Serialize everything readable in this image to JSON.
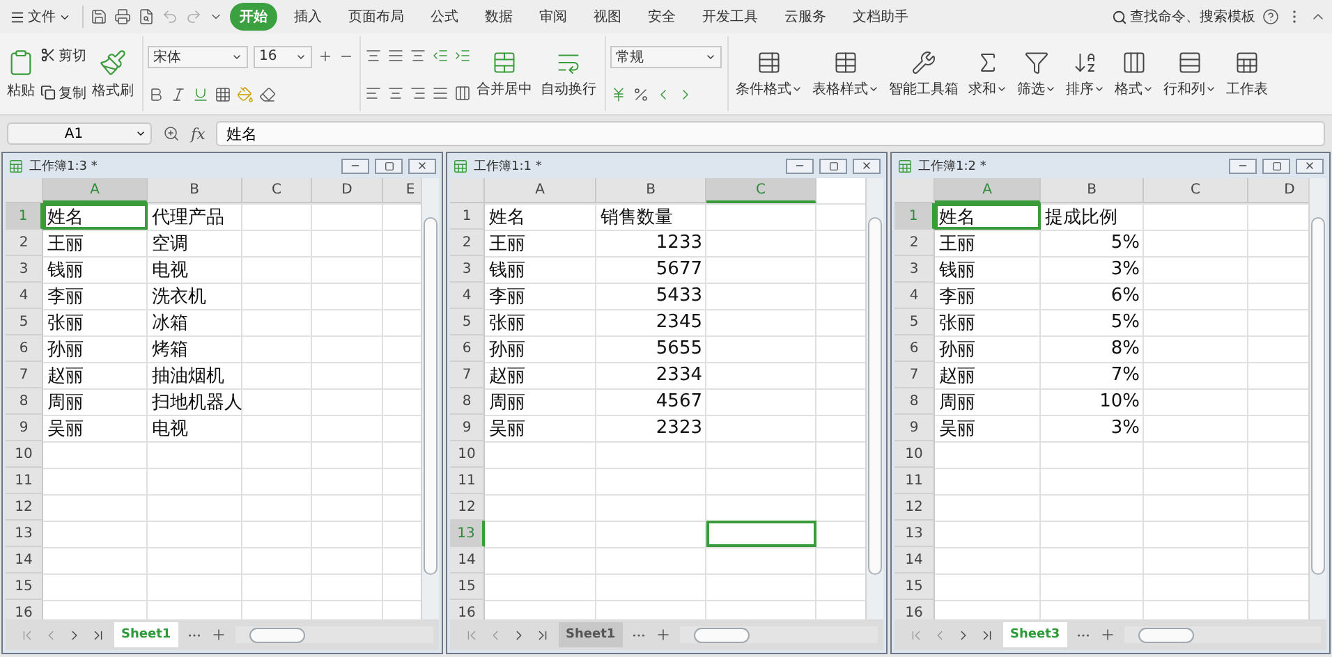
{
  "menu_bar": {
    "file": "文件",
    "tabs": [
      {
        "label": "开始",
        "selected": true
      },
      {
        "label": "插入",
        "selected": false
      },
      {
        "label": "页面布局",
        "selected": false
      },
      {
        "label": "公式",
        "selected": false
      },
      {
        "label": "数据",
        "selected": false
      },
      {
        "label": "审阅",
        "selected": false
      },
      {
        "label": "视图",
        "selected": false
      },
      {
        "label": "安全",
        "selected": false
      },
      {
        "label": "开发工具",
        "selected": false
      },
      {
        "label": "云服务",
        "selected": false
      },
      {
        "label": "文档助手",
        "selected": false
      }
    ],
    "search": "查找命令、搜索模板"
  },
  "ribbon": {
    "paste": "粘贴",
    "cut": "剪切",
    "copy": "复制",
    "format_painter": "格式刷",
    "font_name": "宋体",
    "font_size": "16",
    "merge": "合并居中",
    "wrap": "自动换行",
    "number_format": "常规",
    "tools": [
      {
        "label": "条件格式",
        "dropdown": true
      },
      {
        "label": "表格样式",
        "dropdown": true
      },
      {
        "label": "智能工具箱",
        "dropdown": false
      },
      {
        "label": "求和",
        "dropdown": true
      },
      {
        "label": "筛选",
        "dropdown": true
      },
      {
        "label": "排序",
        "dropdown": true
      },
      {
        "label": "格式",
        "dropdown": true
      },
      {
        "label": "行和列",
        "dropdown": true
      },
      {
        "label": "工作表",
        "dropdown": false
      }
    ]
  },
  "formula_bar": {
    "name_box": "A1",
    "function_label": "fx",
    "formula": "姓名"
  },
  "windows": [
    {
      "title": "工作簿1:3 *",
      "columns": [
        {
          "label": "A",
          "selected": true
        },
        {
          "label": "B",
          "selected": false
        },
        {
          "label": "C",
          "selected": false
        },
        {
          "label": "D",
          "selected": false
        },
        {
          "label": "E",
          "selected": false
        }
      ],
      "rows": [
        {
          "label": "1",
          "selected": true,
          "cells": [
            {
              "text": "姓名",
              "kind": "text",
              "selected": true
            },
            {
              "text": "代理产品",
              "kind": "text",
              "selected": false
            }
          ]
        },
        {
          "label": "2",
          "selected": false,
          "cells": [
            {
              "text": "王丽",
              "kind": "text",
              "selected": false
            },
            {
              "text": "空调",
              "kind": "text",
              "selected": false
            }
          ]
        },
        {
          "label": "3",
          "selected": false,
          "cells": [
            {
              "text": "钱丽",
              "kind": "text",
              "selected": false
            },
            {
              "text": "电视",
              "kind": "text",
              "selected": false
            }
          ]
        },
        {
          "label": "4",
          "selected": false,
          "cells": [
            {
              "text": "李丽",
              "kind": "text",
              "selected": false
            },
            {
              "text": "洗衣机",
              "kind": "text",
              "selected": false
            }
          ]
        },
        {
          "label": "5",
          "selected": false,
          "cells": [
            {
              "text": "张丽",
              "kind": "text",
              "selected": false
            },
            {
              "text": "冰箱",
              "kind": "text",
              "selected": false
            }
          ]
        },
        {
          "label": "6",
          "selected": false,
          "cells": [
            {
              "text": "孙丽",
              "kind": "text",
              "selected": false
            },
            {
              "text": "烤箱",
              "kind": "text",
              "selected": false
            }
          ]
        },
        {
          "label": "7",
          "selected": false,
          "cells": [
            {
              "text": "赵丽",
              "kind": "text",
              "selected": false
            },
            {
              "text": "抽油烟机",
              "kind": "text",
              "selected": false
            }
          ]
        },
        {
          "label": "8",
          "selected": false,
          "cells": [
            {
              "text": "周丽",
              "kind": "text",
              "selected": false
            },
            {
              "text": "扫地机器人",
              "kind": "text",
              "selected": false
            }
          ]
        },
        {
          "label": "9",
          "selected": false,
          "cells": [
            {
              "text": "吴丽",
              "kind": "text",
              "selected": false
            },
            {
              "text": "电视",
              "kind": "text",
              "selected": false
            }
          ]
        },
        {
          "label": "10",
          "selected": false,
          "cells": []
        },
        {
          "label": "11",
          "selected": false,
          "cells": []
        },
        {
          "label": "12",
          "selected": false,
          "cells": []
        },
        {
          "label": "13",
          "selected": false,
          "cells": []
        },
        {
          "label": "14",
          "selected": false,
          "cells": []
        },
        {
          "label": "15",
          "selected": false,
          "cells": []
        },
        {
          "label": "16",
          "selected": false,
          "cells": []
        }
      ],
      "sheet_tab": {
        "label": "Sheet1",
        "selected": true
      }
    },
    {
      "title": "工作簿1:1 *",
      "columns": [
        {
          "label": "A",
          "selected": false
        },
        {
          "label": "B",
          "selected": false
        },
        {
          "label": "C",
          "selected": true
        }
      ],
      "rows": [
        {
          "label": "1",
          "selected": false,
          "cells": [
            {
              "text": "姓名",
              "kind": "text",
              "selected": false
            },
            {
              "text": "销售数量",
              "kind": "text",
              "selected": false
            }
          ]
        },
        {
          "label": "2",
          "selected": false,
          "cells": [
            {
              "text": "王丽",
              "kind": "text",
              "selected": false
            },
            {
              "text": "1233",
              "kind": "number",
              "selected": false
            }
          ]
        },
        {
          "label": "3",
          "selected": false,
          "cells": [
            {
              "text": "钱丽",
              "kind": "text",
              "selected": false
            },
            {
              "text": "5677",
              "kind": "number",
              "selected": false
            }
          ]
        },
        {
          "label": "4",
          "selected": false,
          "cells": [
            {
              "text": "李丽",
              "kind": "text",
              "selected": false
            },
            {
              "text": "5433",
              "kind": "number",
              "selected": false
            }
          ]
        },
        {
          "label": "5",
          "selected": false,
          "cells": [
            {
              "text": "张丽",
              "kind": "text",
              "selected": false
            },
            {
              "text": "2345",
              "kind": "number",
              "selected": false
            }
          ]
        },
        {
          "label": "6",
          "selected": false,
          "cells": [
            {
              "text": "孙丽",
              "kind": "text",
              "selected": false
            },
            {
              "text": "5655",
              "kind": "number",
              "selected": false
            }
          ]
        },
        {
          "label": "7",
          "selected": false,
          "cells": [
            {
              "text": "赵丽",
              "kind": "text",
              "selected": false
            },
            {
              "text": "2334",
              "kind": "number",
              "selected": false
            }
          ]
        },
        {
          "label": "8",
          "selected": false,
          "cells": [
            {
              "text": "周丽",
              "kind": "text",
              "selected": false
            },
            {
              "text": "4567",
              "kind": "number",
              "selected": false
            }
          ]
        },
        {
          "label": "9",
          "selected": false,
          "cells": [
            {
              "text": "吴丽",
              "kind": "text",
              "selected": false
            },
            {
              "text": "2323",
              "kind": "number",
              "selected": false
            }
          ]
        },
        {
          "label": "10",
          "selected": false,
          "cells": []
        },
        {
          "label": "11",
          "selected": false,
          "cells": []
        },
        {
          "label": "12",
          "selected": false,
          "cells": []
        },
        {
          "label": "13",
          "selected": true,
          "cells": [
            {
              "kind": "blank"
            },
            {
              "kind": "blank"
            },
            {
              "kind": "blank",
              "selected": true
            }
          ]
        },
        {
          "label": "14",
          "selected": false,
          "cells": []
        },
        {
          "label": "15",
          "selected": false,
          "cells": []
        },
        {
          "label": "16",
          "selected": false,
          "cells": []
        }
      ],
      "sheet_tab": {
        "label": "Sheet1",
        "selected": false
      }
    },
    {
      "title": "工作簿1:2 *",
      "columns": [
        {
          "label": "A",
          "selected": true
        },
        {
          "label": "B",
          "selected": false
        },
        {
          "label": "C",
          "selected": false
        },
        {
          "label": "D",
          "selected": false
        }
      ],
      "rows": [
        {
          "label": "1",
          "selected": true,
          "cells": [
            {
              "text": "姓名",
              "kind": "text",
              "selected": true
            },
            {
              "text": "提成比例",
              "kind": "text",
              "selected": false
            }
          ]
        },
        {
          "label": "2",
          "selected": false,
          "cells": [
            {
              "text": "王丽",
              "kind": "text",
              "selected": false
            },
            {
              "text": "5%",
              "kind": "number",
              "selected": false
            }
          ]
        },
        {
          "label": "3",
          "selected": false,
          "cells": [
            {
              "text": "钱丽",
              "kind": "text",
              "selected": false
            },
            {
              "text": "3%",
              "kind": "number",
              "selected": false
            }
          ]
        },
        {
          "label": "4",
          "selected": false,
          "cells": [
            {
              "text": "李丽",
              "kind": "text",
              "selected": false
            },
            {
              "text": "6%",
              "kind": "number",
              "selected": false
            }
          ]
        },
        {
          "label": "5",
          "selected": false,
          "cells": [
            {
              "text": "张丽",
              "kind": "text",
              "selected": false
            },
            {
              "text": "5%",
              "kind": "number",
              "selected": false
            }
          ]
        },
        {
          "label": "6",
          "selected": false,
          "cells": [
            {
              "text": "孙丽",
              "kind": "text",
              "selected": false
            },
            {
              "text": "8%",
              "kind": "number",
              "selected": false
            }
          ]
        },
        {
          "label": "7",
          "selected": false,
          "cells": [
            {
              "text": "赵丽",
              "kind": "text",
              "selected": false
            },
            {
              "text": "7%",
              "kind": "number",
              "selected": false
            }
          ]
        },
        {
          "label": "8",
          "selected": false,
          "cells": [
            {
              "text": "周丽",
              "kind": "text",
              "selected": false
            },
            {
              "text": "10%",
              "kind": "number",
              "selected": false
            }
          ]
        },
        {
          "label": "9",
          "selected": false,
          "cells": [
            {
              "text": "吴丽",
              "kind": "text",
              "selected": false
            },
            {
              "text": "3%",
              "kind": "number",
              "selected": false
            }
          ]
        },
        {
          "label": "10",
          "selected": false,
          "cells": []
        },
        {
          "label": "11",
          "selected": false,
          "cells": []
        },
        {
          "label": "12",
          "selected": false,
          "cells": []
        },
        {
          "label": "13",
          "selected": false,
          "cells": []
        },
        {
          "label": "14",
          "selected": false,
          "cells": []
        },
        {
          "label": "15",
          "selected": false,
          "cells": []
        },
        {
          "label": "16",
          "selected": false,
          "cells": []
        }
      ],
      "sheet_tab": {
        "label": "Sheet3",
        "selected": true
      }
    }
  ]
}
